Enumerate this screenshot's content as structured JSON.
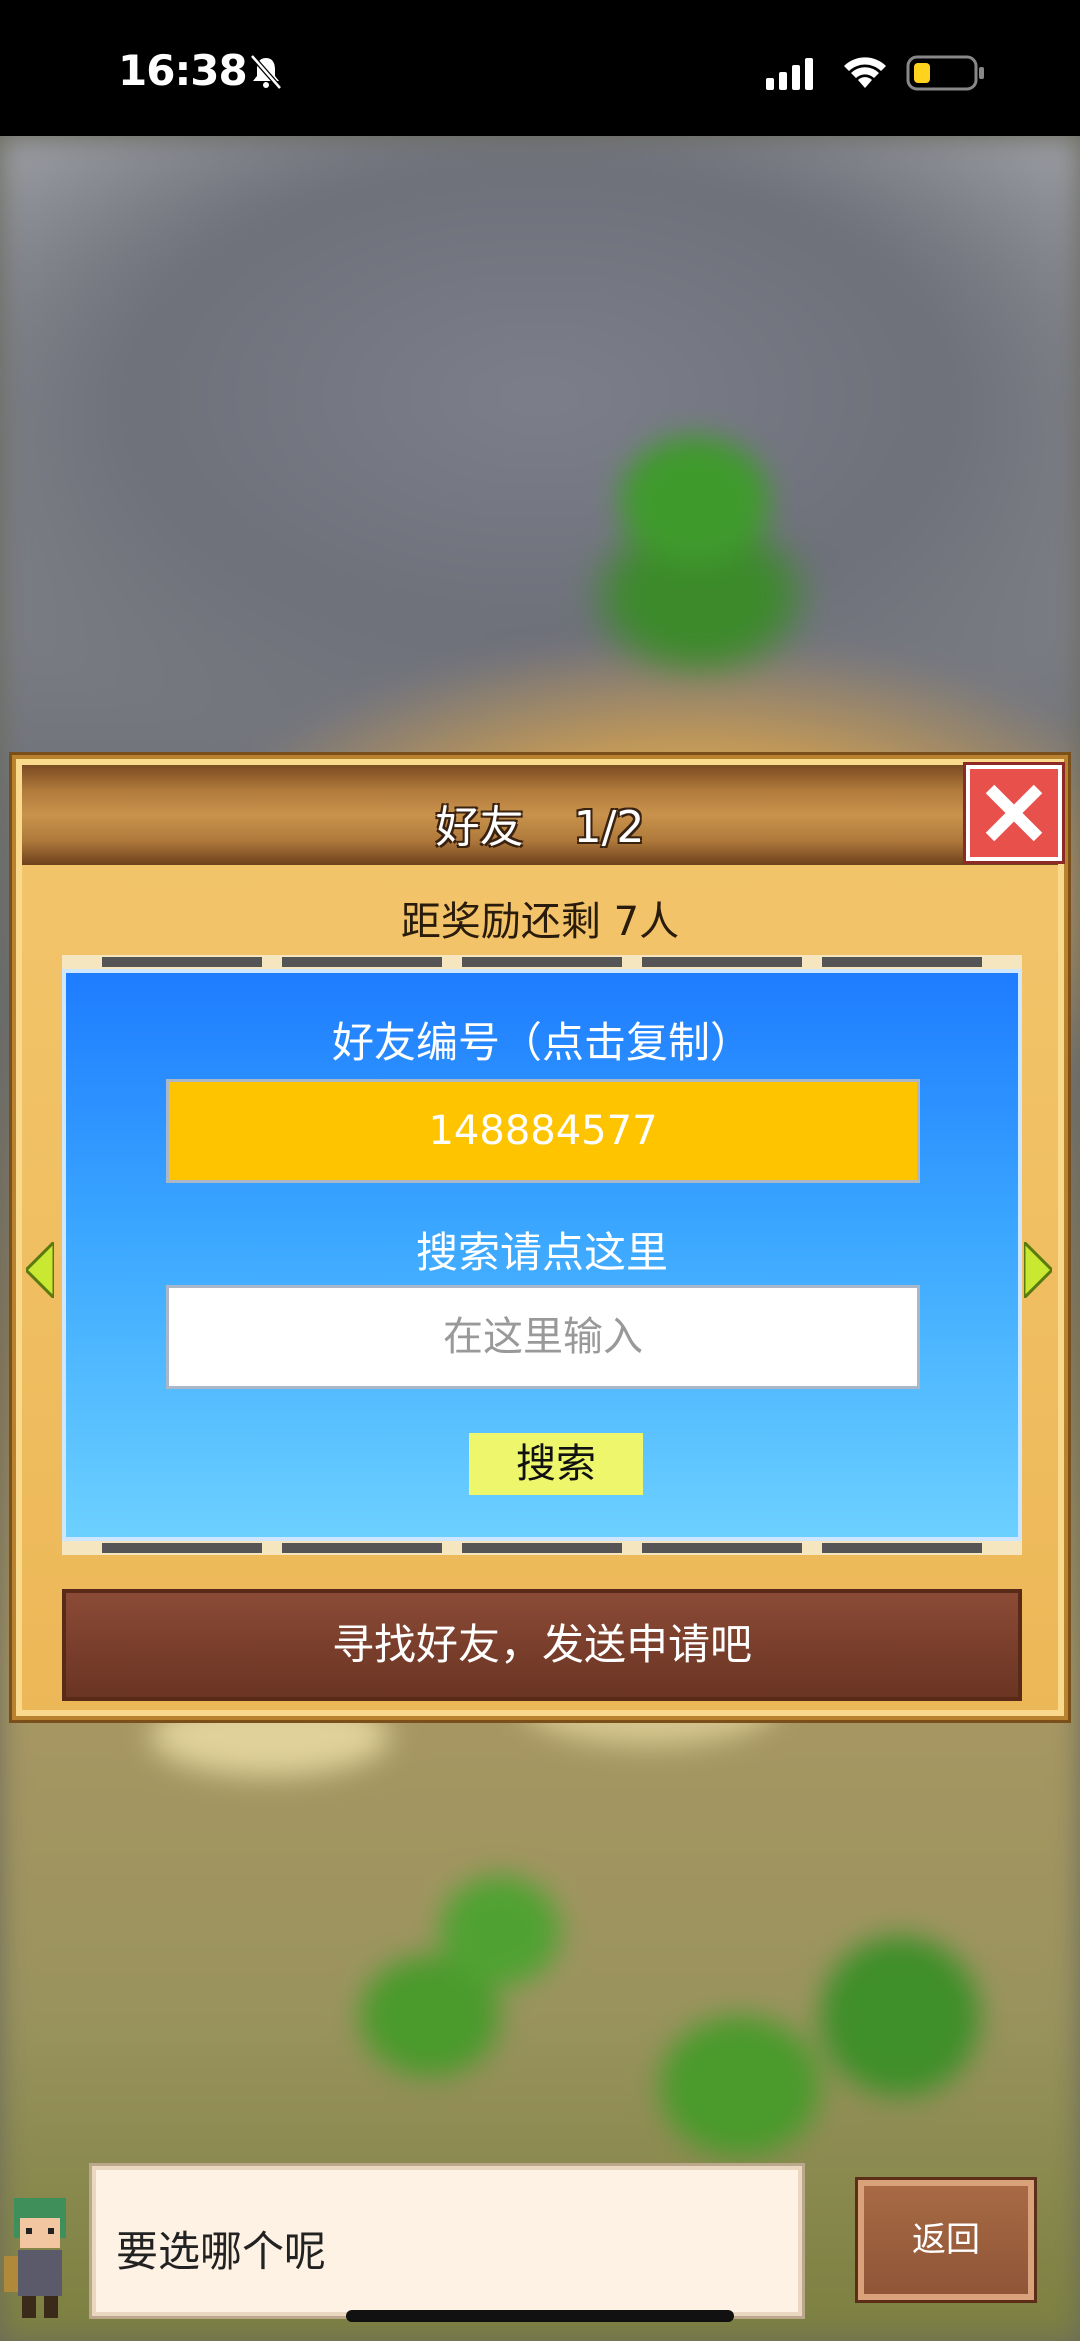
{
  "status_bar": {
    "time": "16:38",
    "icons": [
      "bell-mute-icon",
      "cellular-signal-icon",
      "wifi-icon",
      "battery-low-icon"
    ],
    "battery_color": "#ffd21e"
  },
  "dialog": {
    "title": "好友",
    "page": "1/2",
    "reward_text": "距奖励还剩 7人",
    "friend_id_label": "好友编号（点击复制）",
    "friend_id": "148884577",
    "search_label": "搜索请点这里",
    "search_placeholder": "在这里输入",
    "search_button": "搜索",
    "find_button": "寻找好友，发送申请吧"
  },
  "message": {
    "text": "要选哪个呢"
  },
  "back_button": "返回",
  "colors": {
    "id_box": "#ffc400",
    "search_button": "#eef66b",
    "close_button": "#e8504c",
    "panel_top": "#1e7cff",
    "panel_bottom": "#6cd0ff"
  }
}
